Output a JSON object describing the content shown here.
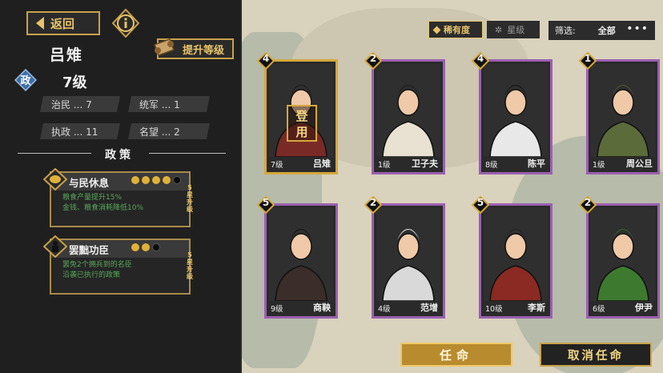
{
  "header": {
    "back_label": "返回",
    "upgrade_label": "提升等级"
  },
  "hero": {
    "name": "吕雉",
    "gov_badge": "政",
    "level": "7级",
    "stats": [
      {
        "label": "治民 ... 7"
      },
      {
        "label": "统军 ... 1"
      },
      {
        "label": "执政 ... 11"
      },
      {
        "label": "名望 ... 2"
      }
    ]
  },
  "policies_title": "政策",
  "policies": [
    {
      "name": "与民休息",
      "desc_line1": "粮食产量提升15%",
      "desc_line2": "金钱、粮食消耗降低10%",
      "filled": 4,
      "total": 5,
      "stars": "5星升级",
      "icon": "leaf-icon"
    },
    {
      "name": "罢黜功臣",
      "desc_line1": "罢免2个拥兵到的名臣",
      "desc_line2": "沿袭已执行的政策",
      "filled": 2,
      "total": 3,
      "stars": "5星升级",
      "icon": "figure-icon"
    }
  ],
  "tabs": {
    "rarity_label": "稀有度",
    "star_label": "星级"
  },
  "filter": {
    "label": "筛选:",
    "value": "全部",
    "more": "•••"
  },
  "cards": [
    {
      "rarity": "4",
      "level": "7级",
      "name": "吕雉",
      "gold": true,
      "in_use": "登用"
    },
    {
      "rarity": "2",
      "level": "1级",
      "name": "卫子夫",
      "gold": false
    },
    {
      "rarity": "4",
      "level": "8级",
      "name": "陈平",
      "gold": false
    },
    {
      "rarity": "1",
      "level": "1级",
      "name": "周公旦",
      "gold": false
    },
    {
      "rarity": "5",
      "level": "9级",
      "name": "商鞅",
      "gold": false
    },
    {
      "rarity": "2",
      "level": "4级",
      "name": "范增",
      "gold": false
    },
    {
      "rarity": "5",
      "level": "10级",
      "name": "李斯",
      "gold": false
    },
    {
      "rarity": "2",
      "level": "6级",
      "name": "伊尹",
      "gold": false
    }
  ],
  "actions": {
    "appoint_label": "任命",
    "dismiss_label": "取消任命"
  },
  "colors": {
    "gold": "#d4a83c",
    "purple": "#9b5fb0",
    "policy_text": "#59a85a"
  }
}
